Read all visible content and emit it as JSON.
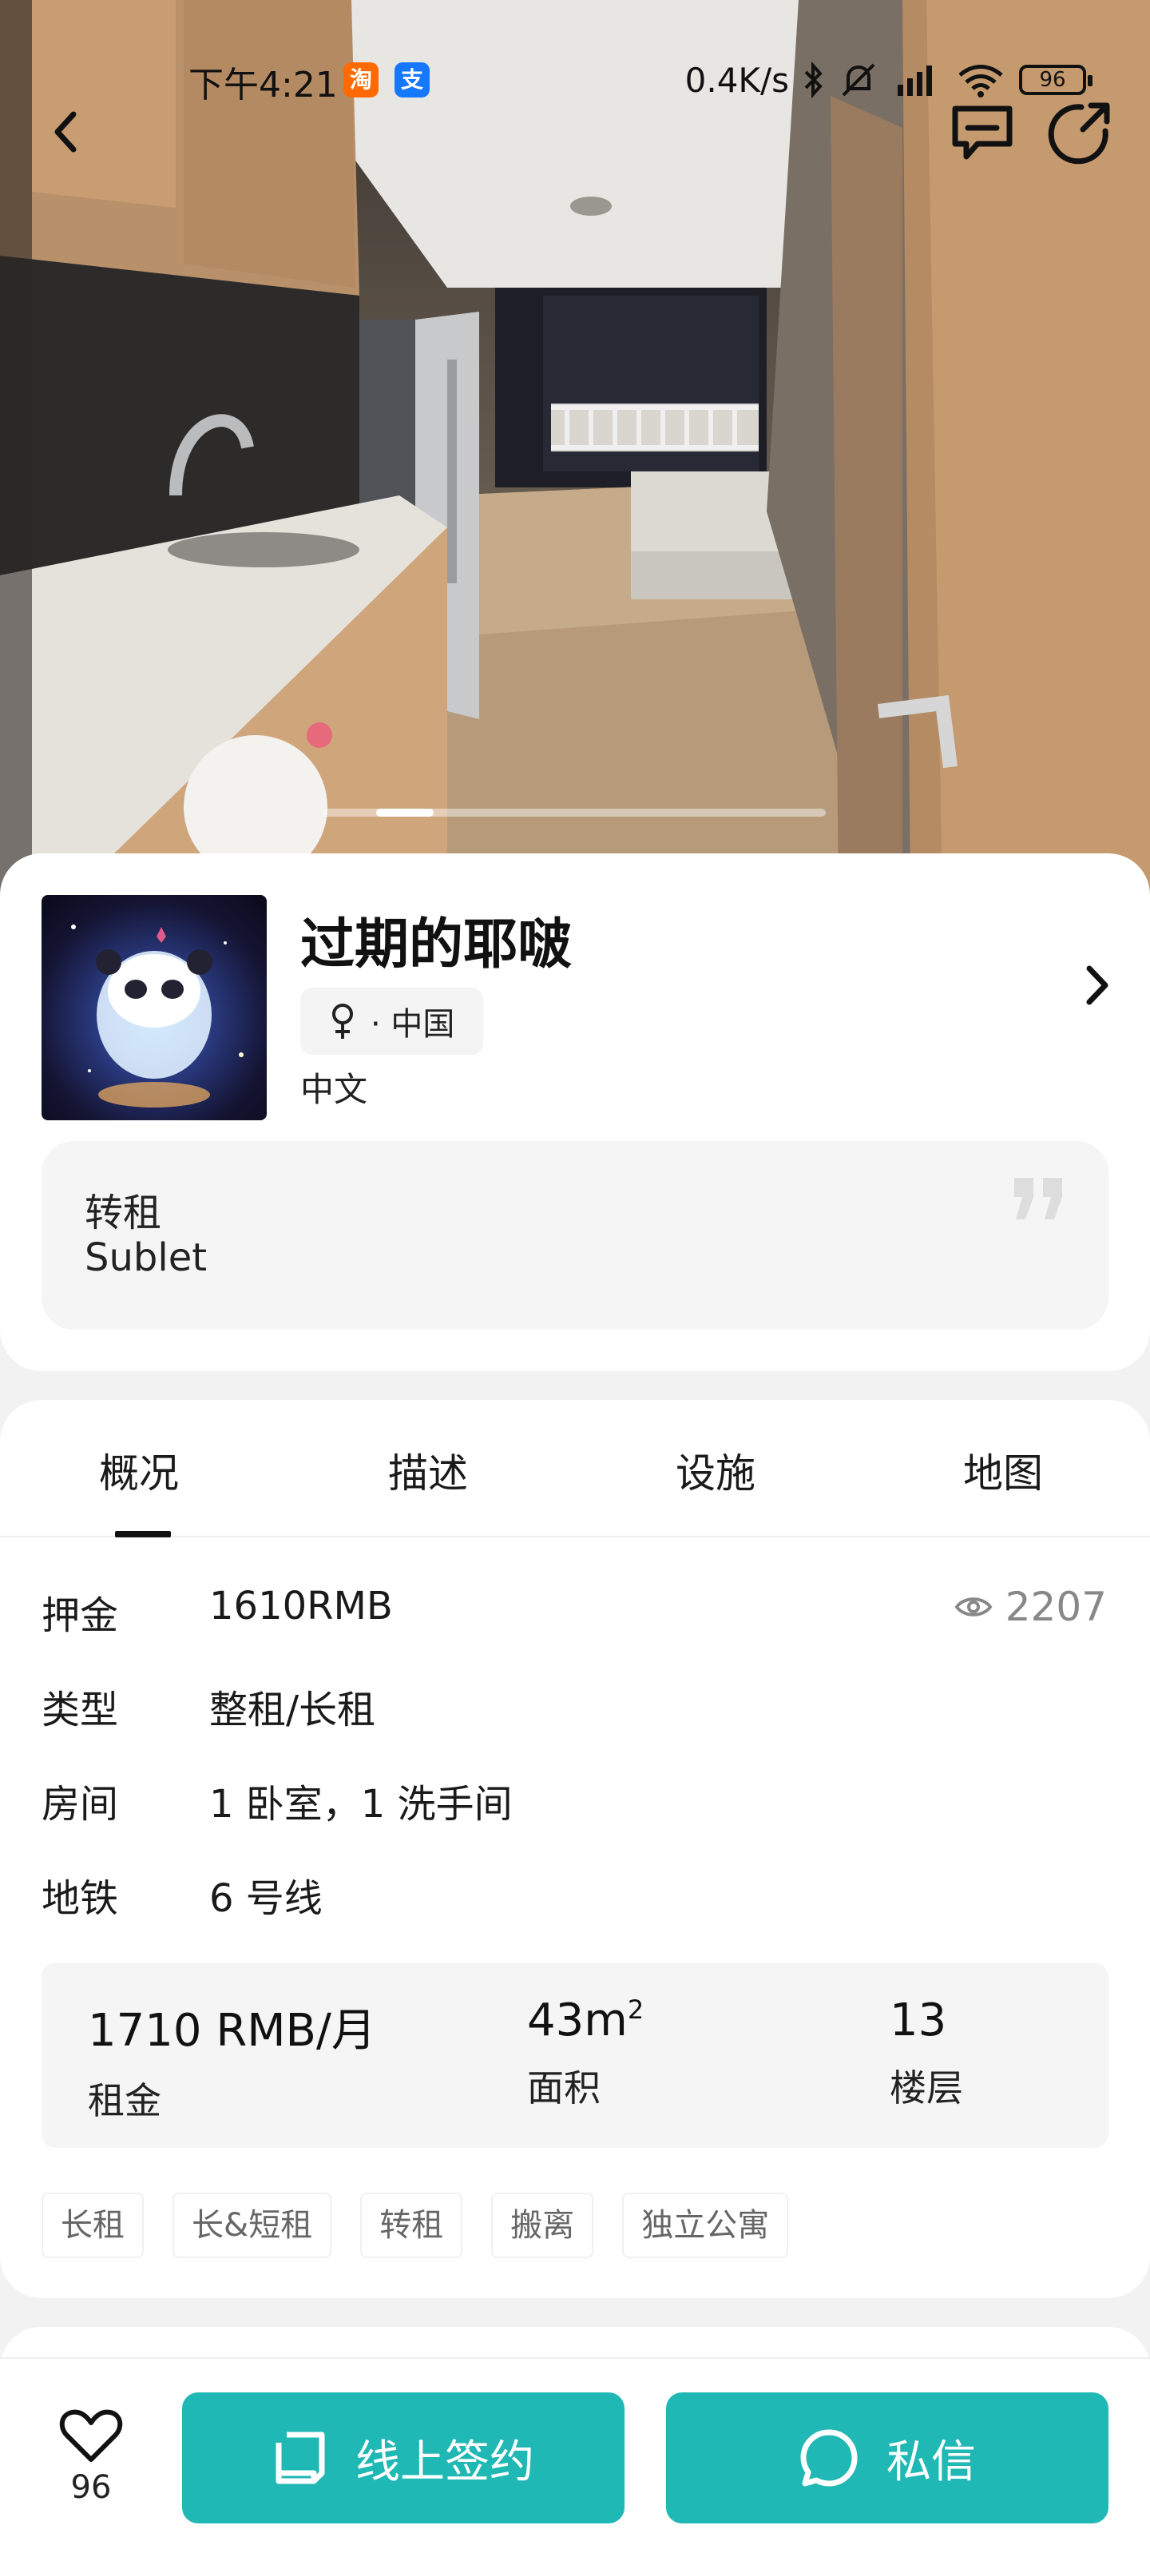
{
  "status_bar": {
    "time": "下午4:21",
    "app_badges": [
      "淘",
      "支"
    ],
    "net_speed": "0.4K/s",
    "battery": "96"
  },
  "header": {
    "icons": [
      "back-icon",
      "message-icon",
      "share-icon"
    ]
  },
  "gallery": {
    "indicator_position": 0.12
  },
  "profile": {
    "name": "过期的耶啵",
    "gender_icon": "female-icon",
    "location": "· 中国",
    "language": "中文",
    "quote_line1": "转租",
    "quote_line2": "Sublet"
  },
  "tabs": [
    "概况",
    "描述",
    "设施",
    "地图"
  ],
  "active_tab": "概况",
  "details": {
    "views": "2207",
    "rows": [
      {
        "label": "押金",
        "value": "1610RMB"
      },
      {
        "label": "类型",
        "value": "整租/长租"
      },
      {
        "label": "房间",
        "value": "1 卧室，1 洗手间"
      },
      {
        "label": "地铁",
        "value": "6 号线"
      }
    ]
  },
  "stats": {
    "rent_value": "1710 RMB/月",
    "rent_label": "租金",
    "area_value": "43m",
    "area_unit_sup": "2",
    "area_label": "面积",
    "floor_value": "13",
    "floor_label": "楼层"
  },
  "tags": [
    "长租",
    "长&短租",
    "转租",
    "搬离",
    "独立公寓"
  ],
  "bottom_bar": {
    "like_count": "96",
    "sign_label": "线上签约",
    "chat_label": "私信"
  },
  "colors": {
    "accent": "#20b8b4",
    "background": "#f2f2f2"
  }
}
